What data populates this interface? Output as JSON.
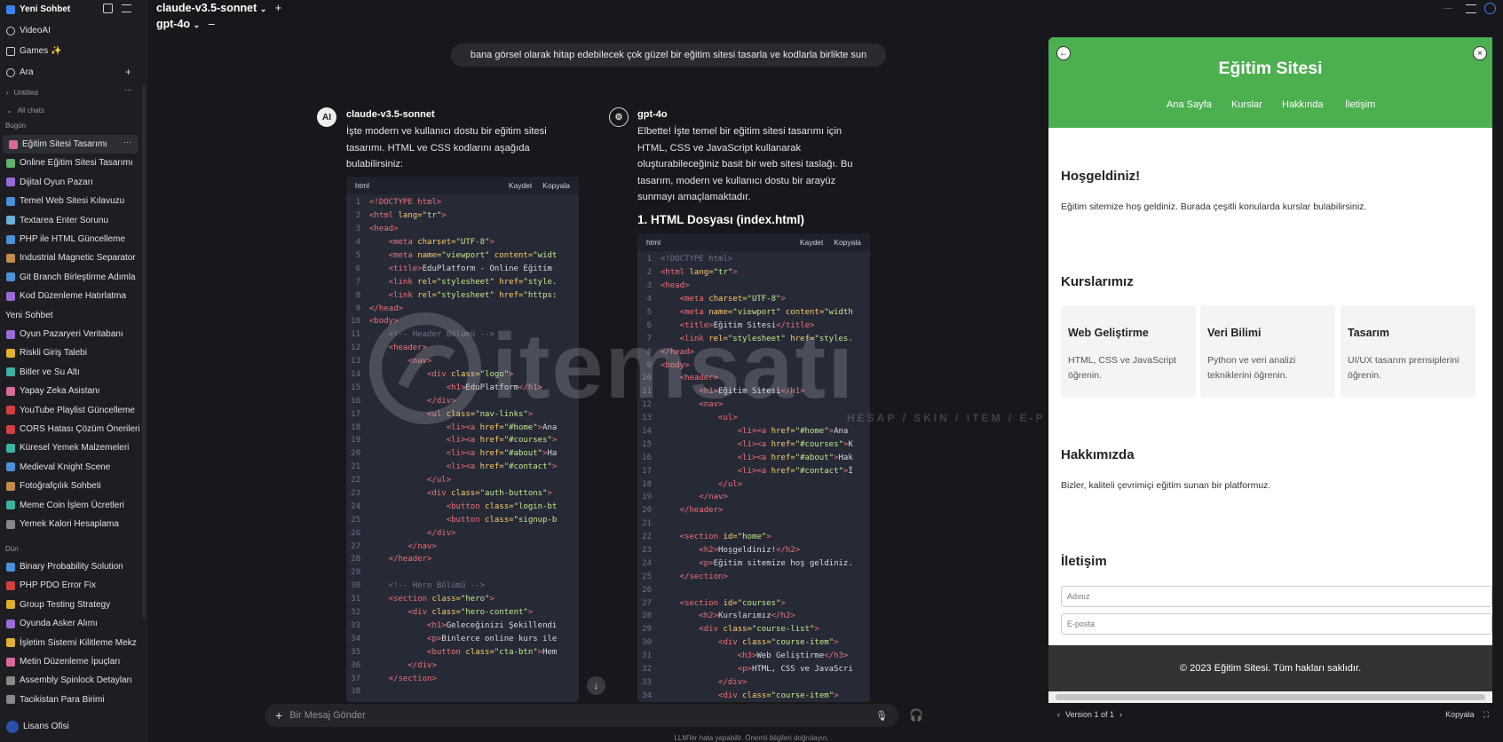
{
  "sidebar": {
    "new_chat": "Yeni Sohbet",
    "items": [
      {
        "label": "VideoAI"
      },
      {
        "label": "Games ✨"
      },
      {
        "label": "Ara"
      }
    ],
    "folder_untitled": "Untitled",
    "all_chats": "All chats",
    "group_today": "Bugün",
    "today": [
      "Eğitim Sitesi Tasarımı",
      "Online Eğitim Sitesi Tasarımı",
      "Dijital Oyun Pazarı",
      "Temel Web Sitesi Kılavuzu",
      "Textarea Enter Sorunu",
      "PHP ile HTML Güncelleme",
      "Industrial Magnetic Separator",
      "Git Branch Birleştirme Adımla",
      "Kod Düzenleme Hatırlatma",
      "Yeni Sohbet",
      "Oyun Pazaryeri Veritabanı",
      "Riskli Giriş Talebi",
      "Bitler ve Su Altı",
      "Yapay Zeka Asistanı",
      "YouTube Playlist Güncelleme",
      "CORS Hatası Çözüm Önerileri",
      "Küresel Yemek Malzemeleri",
      "Medieval Knight Scene",
      "Fotoğrafçılık Sohbeti",
      "Meme Coin İşlem Ücretleri",
      "Yemek Kalori Hesaplama"
    ],
    "group_yesterday": "Dün",
    "yesterday": [
      "Binary Probability Solution",
      "PHP PDO Error Fix",
      "Group Testing Strategy",
      "Oyunda Asker Alımı",
      "İşletim Sistemi Kilitleme Mekz",
      "Metin Düzenleme İpuçları",
      "Assembly Spinlock Detayları",
      "Tacikistan Para Birimi"
    ],
    "user": "Lisans Ofisi"
  },
  "topbar": {
    "model1": "claude-v3.5-sonnet",
    "model2": "gpt-4o",
    "plus": "+",
    "minus": "–"
  },
  "user_message": "bana görsel olarak hitap edebilecek çok güzel bir eğitim sitesi tasarla ve kodlarla birlikte sun",
  "claude": {
    "name": "claude-v3.5-sonnet",
    "intro": [
      "İşte modern ve kullanıcı dostu bir eğitim sitesi",
      "tasarımı. HTML ve CSS kodlarını aşağıda",
      "bulabilirsiniz:"
    ],
    "code_lang": "html",
    "save": "Kaydet",
    "copy": "Kopyala",
    "lines": [
      [
        {
          "c": "tg",
          "t": "<!DOCTYPE html>"
        }
      ],
      [
        {
          "c": "tg",
          "t": "<html "
        },
        {
          "c": "at",
          "t": "lang="
        },
        {
          "c": "st",
          "t": "\"tr\""
        },
        {
          "c": "tg",
          "t": ">"
        }
      ],
      [
        {
          "c": "tg",
          "t": "<head>"
        }
      ],
      [
        {
          "c": "tg",
          "t": "    <meta "
        },
        {
          "c": "at",
          "t": "charset="
        },
        {
          "c": "st",
          "t": "\"UTF-8\""
        },
        {
          "c": "tg",
          "t": ">"
        }
      ],
      [
        {
          "c": "tg",
          "t": "    <meta "
        },
        {
          "c": "at",
          "t": "name="
        },
        {
          "c": "st",
          "t": "\"viewport\" "
        },
        {
          "c": "at",
          "t": "content="
        },
        {
          "c": "st",
          "t": "\"widt"
        }
      ],
      [
        {
          "c": "tg",
          "t": "    <title>"
        },
        {
          "c": "tx",
          "t": "EduPlatform - Online Eğitim"
        }
      ],
      [
        {
          "c": "tg",
          "t": "    <link "
        },
        {
          "c": "at",
          "t": "rel="
        },
        {
          "c": "st",
          "t": "\"stylesheet\" "
        },
        {
          "c": "at",
          "t": "href="
        },
        {
          "c": "st",
          "t": "\"style."
        }
      ],
      [
        {
          "c": "tg",
          "t": "    <link "
        },
        {
          "c": "at",
          "t": "rel="
        },
        {
          "c": "st",
          "t": "\"stylesheet\" "
        },
        {
          "c": "at",
          "t": "href="
        },
        {
          "c": "st",
          "t": "\"https:"
        }
      ],
      [
        {
          "c": "tg",
          "t": "</head>"
        }
      ],
      [
        {
          "c": "tg",
          "t": "<body>"
        }
      ],
      [
        {
          "c": "cm",
          "t": "    <!-- Header Bölümü -->"
        }
      ],
      [
        {
          "c": "tg",
          "t": "    <header>"
        }
      ],
      [
        {
          "c": "tg",
          "t": "        <nav>"
        }
      ],
      [
        {
          "c": "tg",
          "t": "            <div "
        },
        {
          "c": "at",
          "t": "class="
        },
        {
          "c": "st",
          "t": "\"logo\""
        },
        {
          "c": "tg",
          "t": ">"
        }
      ],
      [
        {
          "c": "tg",
          "t": "                <h1>"
        },
        {
          "c": "tx",
          "t": "EduPlatform"
        },
        {
          "c": "tg",
          "t": "</h1>"
        }
      ],
      [
        {
          "c": "tg",
          "t": "            </div>"
        }
      ],
      [
        {
          "c": "tg",
          "t": "            <ul "
        },
        {
          "c": "at",
          "t": "class="
        },
        {
          "c": "st",
          "t": "\"nav-links\""
        },
        {
          "c": "tg",
          "t": ">"
        }
      ],
      [
        {
          "c": "tg",
          "t": "                <li><a "
        },
        {
          "c": "at",
          "t": "href="
        },
        {
          "c": "st",
          "t": "\"#home\""
        },
        {
          "c": "tg",
          "t": ">"
        },
        {
          "c": "tx",
          "t": "Ana"
        }
      ],
      [
        {
          "c": "tg",
          "t": "                <li><a "
        },
        {
          "c": "at",
          "t": "href="
        },
        {
          "c": "st",
          "t": "\"#courses\""
        },
        {
          "c": "tg",
          "t": ">"
        }
      ],
      [
        {
          "c": "tg",
          "t": "                <li><a "
        },
        {
          "c": "at",
          "t": "href="
        },
        {
          "c": "st",
          "t": "\"#about\""
        },
        {
          "c": "tg",
          "t": ">"
        },
        {
          "c": "tx",
          "t": "Ha"
        }
      ],
      [
        {
          "c": "tg",
          "t": "                <li><a "
        },
        {
          "c": "at",
          "t": "href="
        },
        {
          "c": "st",
          "t": "\"#contact\""
        },
        {
          "c": "tg",
          "t": ">"
        }
      ],
      [
        {
          "c": "tg",
          "t": "            </ul>"
        }
      ],
      [
        {
          "c": "tg",
          "t": "            <div "
        },
        {
          "c": "at",
          "t": "class="
        },
        {
          "c": "st",
          "t": "\"auth-buttons\""
        },
        {
          "c": "tg",
          "t": ">"
        }
      ],
      [
        {
          "c": "tg",
          "t": "                <button "
        },
        {
          "c": "at",
          "t": "class="
        },
        {
          "c": "st",
          "t": "\"login-bt"
        }
      ],
      [
        {
          "c": "tg",
          "t": "                <button "
        },
        {
          "c": "at",
          "t": "class="
        },
        {
          "c": "st",
          "t": "\"signup-b"
        }
      ],
      [
        {
          "c": "tg",
          "t": "            </div>"
        }
      ],
      [
        {
          "c": "tg",
          "t": "        </nav>"
        }
      ],
      [
        {
          "c": "tg",
          "t": "    </header>"
        }
      ],
      [
        {
          "c": "tx",
          "t": ""
        }
      ],
      [
        {
          "c": "cm",
          "t": "    <!-- Hero Bölümü -->"
        }
      ],
      [
        {
          "c": "tg",
          "t": "    <section "
        },
        {
          "c": "at",
          "t": "class="
        },
        {
          "c": "st",
          "t": "\"hero\""
        },
        {
          "c": "tg",
          "t": ">"
        }
      ],
      [
        {
          "c": "tg",
          "t": "        <div "
        },
        {
          "c": "at",
          "t": "class="
        },
        {
          "c": "st",
          "t": "\"hero-content\""
        },
        {
          "c": "tg",
          "t": ">"
        }
      ],
      [
        {
          "c": "tg",
          "t": "            <h1>"
        },
        {
          "c": "tx",
          "t": "Geleceğinizi Şekillendi"
        }
      ],
      [
        {
          "c": "tg",
          "t": "            <p>"
        },
        {
          "c": "tx",
          "t": "Binlerce online kurs ile"
        }
      ],
      [
        {
          "c": "tg",
          "t": "            <button "
        },
        {
          "c": "at",
          "t": "class="
        },
        {
          "c": "st",
          "t": "\"cta-btn\""
        },
        {
          "c": "tg",
          "t": ">"
        },
        {
          "c": "tx",
          "t": "Hem"
        }
      ],
      [
        {
          "c": "tg",
          "t": "        </div>"
        }
      ],
      [
        {
          "c": "tg",
          "t": "    </section>"
        }
      ],
      [
        {
          "c": "tx",
          "t": ""
        }
      ]
    ]
  },
  "gpt": {
    "name": "gpt-4o",
    "intro": [
      "Elbette! İşte temel bir eğitim sitesi tasarımı için",
      "HTML, CSS ve JavaScript kullanarak",
      "oluşturabileceğiniz basit bir web sitesi taslağı. Bu",
      "tasarım, modern ve kullanıcı dostu bir arayüz",
      "sunmayı amaçlamaktadır."
    ],
    "heading": "1. HTML Dosyası (index.html)",
    "code_lang": "html",
    "save": "Kaydet",
    "copy": "Kopyala",
    "lines": [
      [
        {
          "c": "cm",
          "t": "<!DOCTYPE html>"
        }
      ],
      [
        {
          "c": "tg",
          "t": "<html "
        },
        {
          "c": "at",
          "t": "lang="
        },
        {
          "c": "st",
          "t": "\"tr\""
        },
        {
          "c": "tg",
          "t": ">"
        }
      ],
      [
        {
          "c": "tg",
          "t": "<head>"
        }
      ],
      [
        {
          "c": "tg",
          "t": "    <meta "
        },
        {
          "c": "at",
          "t": "charset="
        },
        {
          "c": "st",
          "t": "\"UTF-8\""
        },
        {
          "c": "tg",
          "t": ">"
        }
      ],
      [
        {
          "c": "tg",
          "t": "    <meta "
        },
        {
          "c": "at",
          "t": "name="
        },
        {
          "c": "st",
          "t": "\"viewport\" "
        },
        {
          "c": "at",
          "t": "content="
        },
        {
          "c": "st",
          "t": "\"width"
        }
      ],
      [
        {
          "c": "tg",
          "t": "    <title>"
        },
        {
          "c": "tx",
          "t": "Eğitim Sitesi"
        },
        {
          "c": "tg",
          "t": "</title>"
        }
      ],
      [
        {
          "c": "tg",
          "t": "    <link "
        },
        {
          "c": "at",
          "t": "rel="
        },
        {
          "c": "st",
          "t": "\"stylesheet\" "
        },
        {
          "c": "at",
          "t": "href="
        },
        {
          "c": "st",
          "t": "\"styles."
        }
      ],
      [
        {
          "c": "tg",
          "t": "</head>"
        }
      ],
      [
        {
          "c": "tg",
          "t": "<body>"
        }
      ],
      [
        {
          "c": "tg",
          "t": "    <header>"
        }
      ],
      [
        {
          "c": "tg",
          "t": "        <h1>"
        },
        {
          "c": "tx",
          "t": "Eğitim Sitesi"
        },
        {
          "c": "tg",
          "t": "</h1>"
        }
      ],
      [
        {
          "c": "tg",
          "t": "        <nav>"
        }
      ],
      [
        {
          "c": "tg",
          "t": "            <ul>"
        }
      ],
      [
        {
          "c": "tg",
          "t": "                <li><a "
        },
        {
          "c": "at",
          "t": "href="
        },
        {
          "c": "st",
          "t": "\"#home\""
        },
        {
          "c": "tg",
          "t": ">"
        },
        {
          "c": "tx",
          "t": "Ana"
        }
      ],
      [
        {
          "c": "tg",
          "t": "                <li><a "
        },
        {
          "c": "at",
          "t": "href="
        },
        {
          "c": "st",
          "t": "\"#courses\""
        },
        {
          "c": "tg",
          "t": ">"
        },
        {
          "c": "tx",
          "t": "K"
        }
      ],
      [
        {
          "c": "tg",
          "t": "                <li><a "
        },
        {
          "c": "at",
          "t": "href="
        },
        {
          "c": "st",
          "t": "\"#about\""
        },
        {
          "c": "tg",
          "t": ">"
        },
        {
          "c": "tx",
          "t": "Hak"
        }
      ],
      [
        {
          "c": "tg",
          "t": "                <li><a "
        },
        {
          "c": "at",
          "t": "href="
        },
        {
          "c": "st",
          "t": "\"#contact\""
        },
        {
          "c": "tg",
          "t": ">"
        },
        {
          "c": "tx",
          "t": "İ"
        }
      ],
      [
        {
          "c": "tg",
          "t": "            </ul>"
        }
      ],
      [
        {
          "c": "tg",
          "t": "        </nav>"
        }
      ],
      [
        {
          "c": "tg",
          "t": "    </header>"
        }
      ],
      [
        {
          "c": "tx",
          "t": ""
        }
      ],
      [
        {
          "c": "tg",
          "t": "    <section "
        },
        {
          "c": "at",
          "t": "id="
        },
        {
          "c": "st",
          "t": "\"home\""
        },
        {
          "c": "tg",
          "t": ">"
        }
      ],
      [
        {
          "c": "tg",
          "t": "        <h2>"
        },
        {
          "c": "tx",
          "t": "Hoşgeldiniz!"
        },
        {
          "c": "tg",
          "t": "</h2>"
        }
      ],
      [
        {
          "c": "tg",
          "t": "        <p>"
        },
        {
          "c": "tx",
          "t": "Eğitim sitemize hoş geldiniz."
        }
      ],
      [
        {
          "c": "tg",
          "t": "    </section>"
        }
      ],
      [
        {
          "c": "tx",
          "t": ""
        }
      ],
      [
        {
          "c": "tg",
          "t": "    <section "
        },
        {
          "c": "at",
          "t": "id="
        },
        {
          "c": "st",
          "t": "\"courses\""
        },
        {
          "c": "tg",
          "t": ">"
        }
      ],
      [
        {
          "c": "tg",
          "t": "        <h2>"
        },
        {
          "c": "tx",
          "t": "Kurslarımız"
        },
        {
          "c": "tg",
          "t": "</h2>"
        }
      ],
      [
        {
          "c": "tg",
          "t": "        <div "
        },
        {
          "c": "at",
          "t": "class="
        },
        {
          "c": "st",
          "t": "\"course-list\""
        },
        {
          "c": "tg",
          "t": ">"
        }
      ],
      [
        {
          "c": "tg",
          "t": "            <div "
        },
        {
          "c": "at",
          "t": "class="
        },
        {
          "c": "st",
          "t": "\"course-item\""
        },
        {
          "c": "tg",
          "t": ">"
        }
      ],
      [
        {
          "c": "tg",
          "t": "                <h3>"
        },
        {
          "c": "tx",
          "t": "Web Geliştirme"
        },
        {
          "c": "tg",
          "t": "</h3>"
        }
      ],
      [
        {
          "c": "tg",
          "t": "                <p>"
        },
        {
          "c": "tx",
          "t": "HTML, CSS ve JavaScri"
        }
      ],
      [
        {
          "c": "tg",
          "t": "            </div>"
        }
      ],
      [
        {
          "c": "tg",
          "t": "            <div "
        },
        {
          "c": "at",
          "t": "class="
        },
        {
          "c": "st",
          "t": "\"course-item\""
        },
        {
          "c": "tg",
          "t": ">"
        }
      ]
    ]
  },
  "preview": {
    "title": "Eğitim Sitesi",
    "nav": [
      "Ana Sayfa",
      "Kurslar",
      "Hakkında",
      "İletişim"
    ],
    "welcome_h": "Hoşgeldiniz!",
    "welcome_p": "Eğitim sitemize hoş geldiniz. Burada çeşitli konularda kurslar bulabilirsiniz.",
    "courses_h": "Kurslarımız",
    "courses": [
      {
        "title": "Web Geliştirme",
        "desc": "HTML, CSS ve JavaScript öğrenin."
      },
      {
        "title": "Veri Bilimi",
        "desc": "Python ve veri analizi tekniklerini öğrenin."
      },
      {
        "title": "Tasarım",
        "desc": "UI/UX tasarım prensiplerini öğrenin."
      }
    ],
    "about_h": "Hakkımızda",
    "about_p": "Bizler, kaliteli çevrimiçi eğitim sunan bir platformuz.",
    "contact_h": "İletişim",
    "name_placeholder": "Adınız",
    "email_placeholder": "E-posta",
    "footer": "© 2023 Eğitim Sitesi. Tüm hakları saklıdır.",
    "version": "Version 1 of 1",
    "copy": "Kopyala"
  },
  "input": {
    "placeholder": "Bir Mesaj Gönder"
  },
  "footnote": "LLM'ler hata yapabilir. Önemli bilgileri doğrulayın.",
  "watermark": {
    "brand": "itemsatı",
    "tagline": "HESAP / SKIN / ITEM / E-P"
  }
}
